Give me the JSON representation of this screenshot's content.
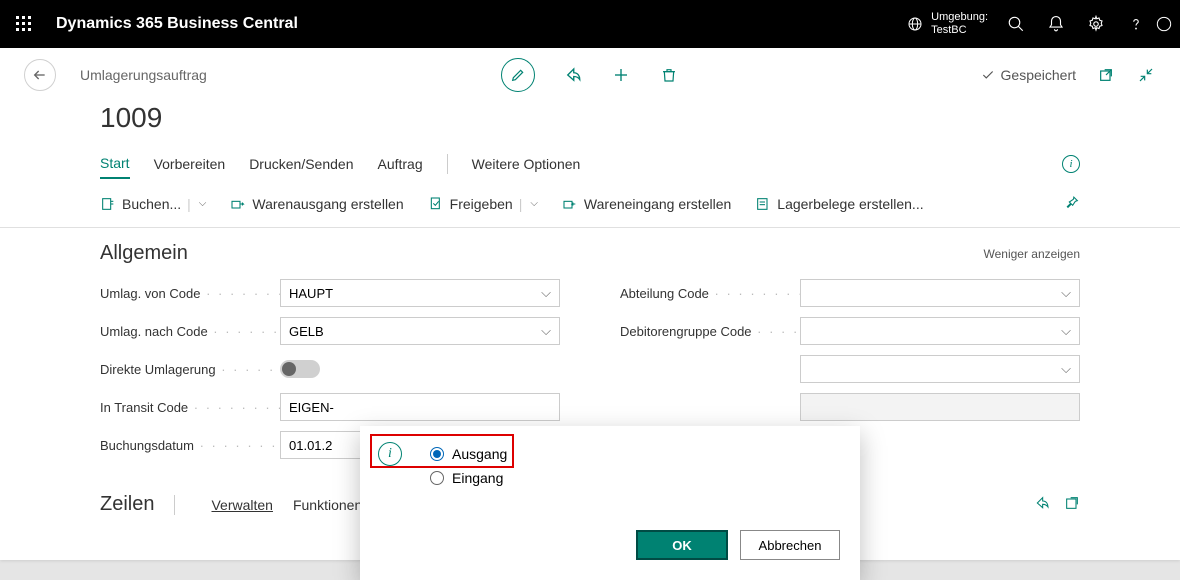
{
  "topbar": {
    "product": "Dynamics 365 Business Central",
    "env_label": "Umgebung:",
    "env_value": "TestBC"
  },
  "card": {
    "breadcrumb": "Umlagerungsauftrag",
    "doc_no": "1009",
    "saved_label": "Gespeichert"
  },
  "tabs": {
    "start": "Start",
    "vorbereiten": "Vorbereiten",
    "drucken": "Drucken/Senden",
    "auftrag": "Auftrag",
    "weitere": "Weitere Optionen"
  },
  "actions": {
    "buchen": "Buchen...",
    "warenausgang": "Warenausgang erstellen",
    "freigeben": "Freigeben",
    "wareneingang": "Wareneingang erstellen",
    "lagerbelege": "Lagerbelege erstellen..."
  },
  "section": {
    "title": "Allgemein",
    "less": "Weniger anzeigen"
  },
  "fields": {
    "umlag_von": {
      "label": "Umlag. von Code",
      "value": "HAUPT"
    },
    "umlag_nach": {
      "label": "Umlag. nach Code",
      "value": "GELB"
    },
    "direkte": {
      "label": "Direkte Umlagerung"
    },
    "transit": {
      "label": "In Transit Code",
      "value": "EIGEN-"
    },
    "buchung": {
      "label": "Buchungsdatum",
      "value": "01.01.2"
    },
    "abteilung": {
      "label": "Abteilung Code",
      "value": ""
    },
    "debitorengruppe": {
      "label": "Debitorengruppe Code",
      "value": ""
    },
    "hidden1": {
      "label": "",
      "value": ""
    }
  },
  "lines": {
    "title": "Zeilen",
    "verwalten": "Verwalten",
    "funktionen": "Funktionen"
  },
  "modal": {
    "ausgang": "Ausgang",
    "eingang": "Eingang",
    "ok": "OK",
    "cancel": "Abbrechen"
  }
}
